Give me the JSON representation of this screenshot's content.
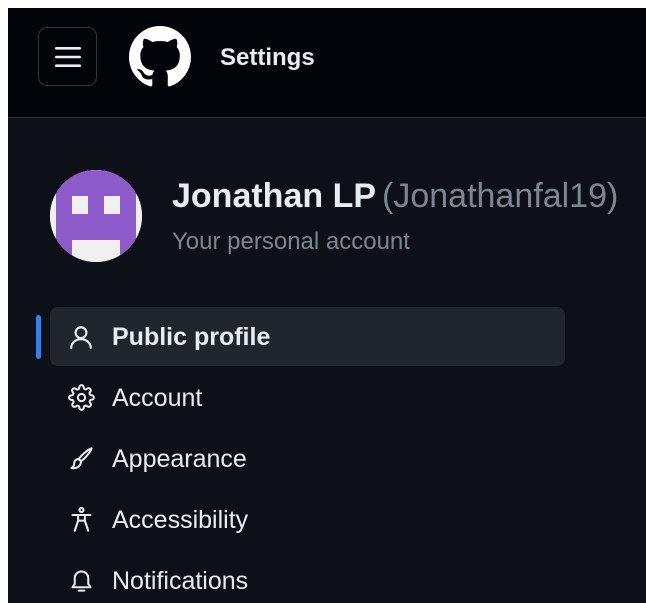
{
  "header": {
    "title": "Settings",
    "menu_icon": "hamburger-menu-icon",
    "logo_icon": "github-mark-icon"
  },
  "profile": {
    "name": "Jonathan LP",
    "login": "(Jonathanfal19)",
    "subtitle": "Your personal account",
    "avatar_colors": {
      "background": "#f0f0f0",
      "pixels": "#8c5bc9"
    }
  },
  "sidebar": {
    "items": [
      {
        "label": "Public profile",
        "icon": "person-icon",
        "active": true
      },
      {
        "label": "Account",
        "icon": "gear-icon",
        "active": false
      },
      {
        "label": "Appearance",
        "icon": "paintbrush-icon",
        "active": false
      },
      {
        "label": "Accessibility",
        "icon": "accessibility-icon",
        "active": false
      },
      {
        "label": "Notifications",
        "icon": "bell-icon",
        "active": false
      }
    ]
  },
  "colors": {
    "header_bg": "#010409",
    "page_bg": "#0d1117",
    "text_primary": "#e6edf3",
    "text_muted": "#7d8590",
    "active_item_bg": "#21262d",
    "active_indicator": "#2f81f7"
  }
}
